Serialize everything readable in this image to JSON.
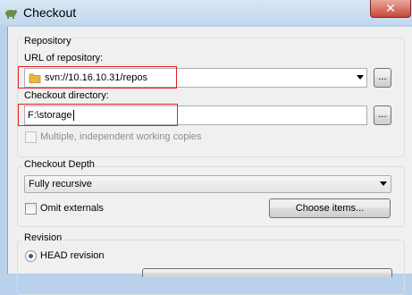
{
  "window": {
    "title": "Checkout",
    "close_glyph": "✕"
  },
  "repository": {
    "group_label": "Repository",
    "url_label": "URL of repository:",
    "url_value": "svn://10.16.10.31/repos",
    "checkout_dir_label": "Checkout directory:",
    "checkout_dir_value": "F:\\storage",
    "browse_label": "...",
    "multiple_label": "Multiple, independent working copies",
    "multiple_checked": false,
    "multiple_enabled": false
  },
  "depth": {
    "group_label": "Checkout Depth",
    "selected": "Fully recursive",
    "omit_label": "Omit externals",
    "omit_checked": false,
    "choose_items_label": "Choose items..."
  },
  "revision": {
    "group_label": "Revision",
    "head_label": "HEAD revision",
    "head_selected": true
  },
  "colors": {
    "highlight": "#e02020",
    "titlebar": "#c2d8ee",
    "close_button": "#c7473a"
  }
}
